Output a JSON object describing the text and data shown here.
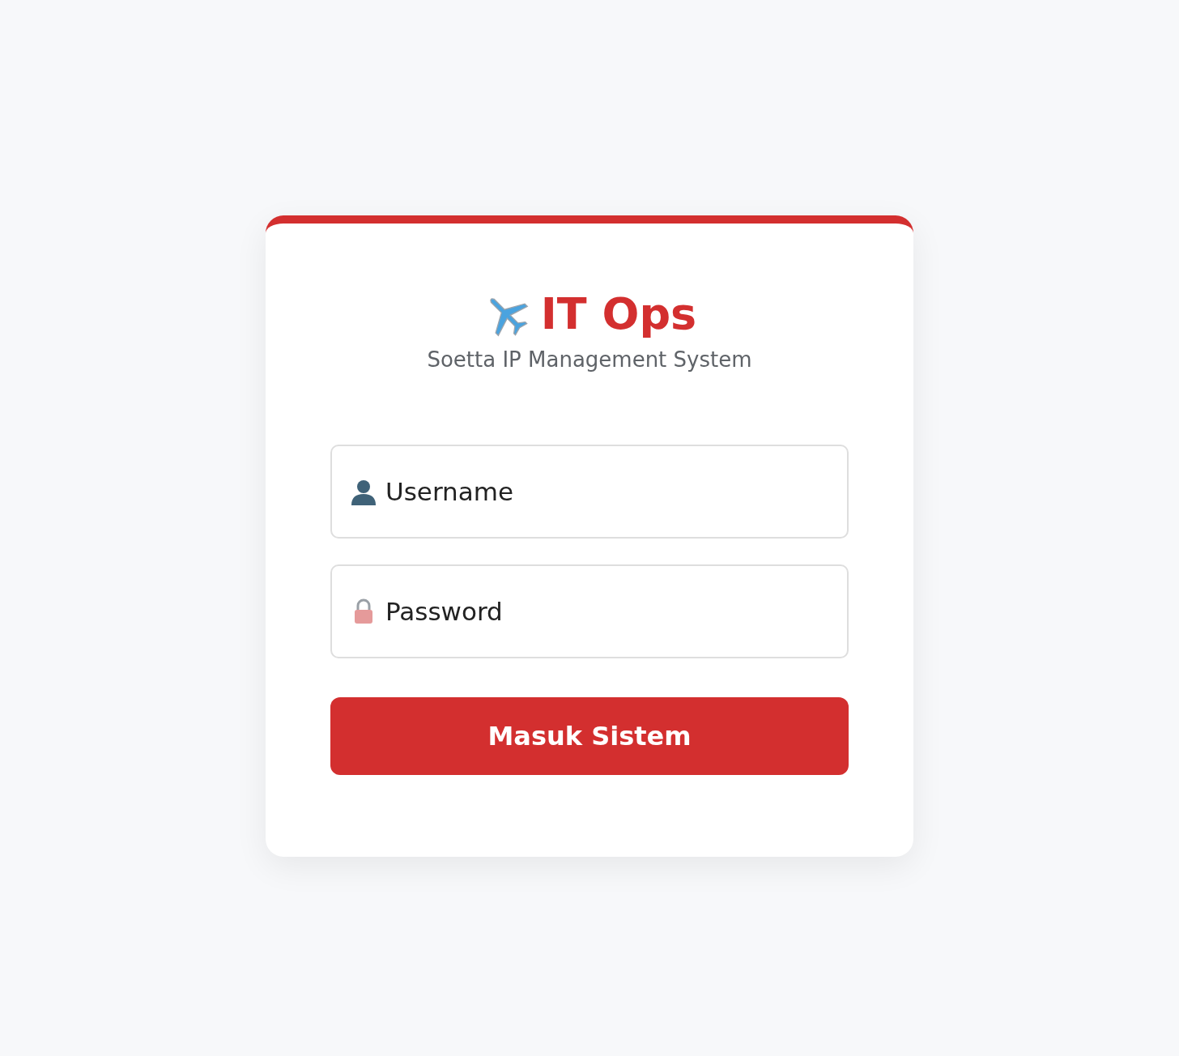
{
  "header": {
    "title": "IT Ops",
    "subtitle": "Soetta IP Management System"
  },
  "fields": [
    {
      "kind": "text",
      "placeholder": "Username"
    },
    {
      "kind": "password",
      "placeholder": "Password"
    }
  ],
  "submit_button": {
    "label": "Masuk Sistem"
  }
}
